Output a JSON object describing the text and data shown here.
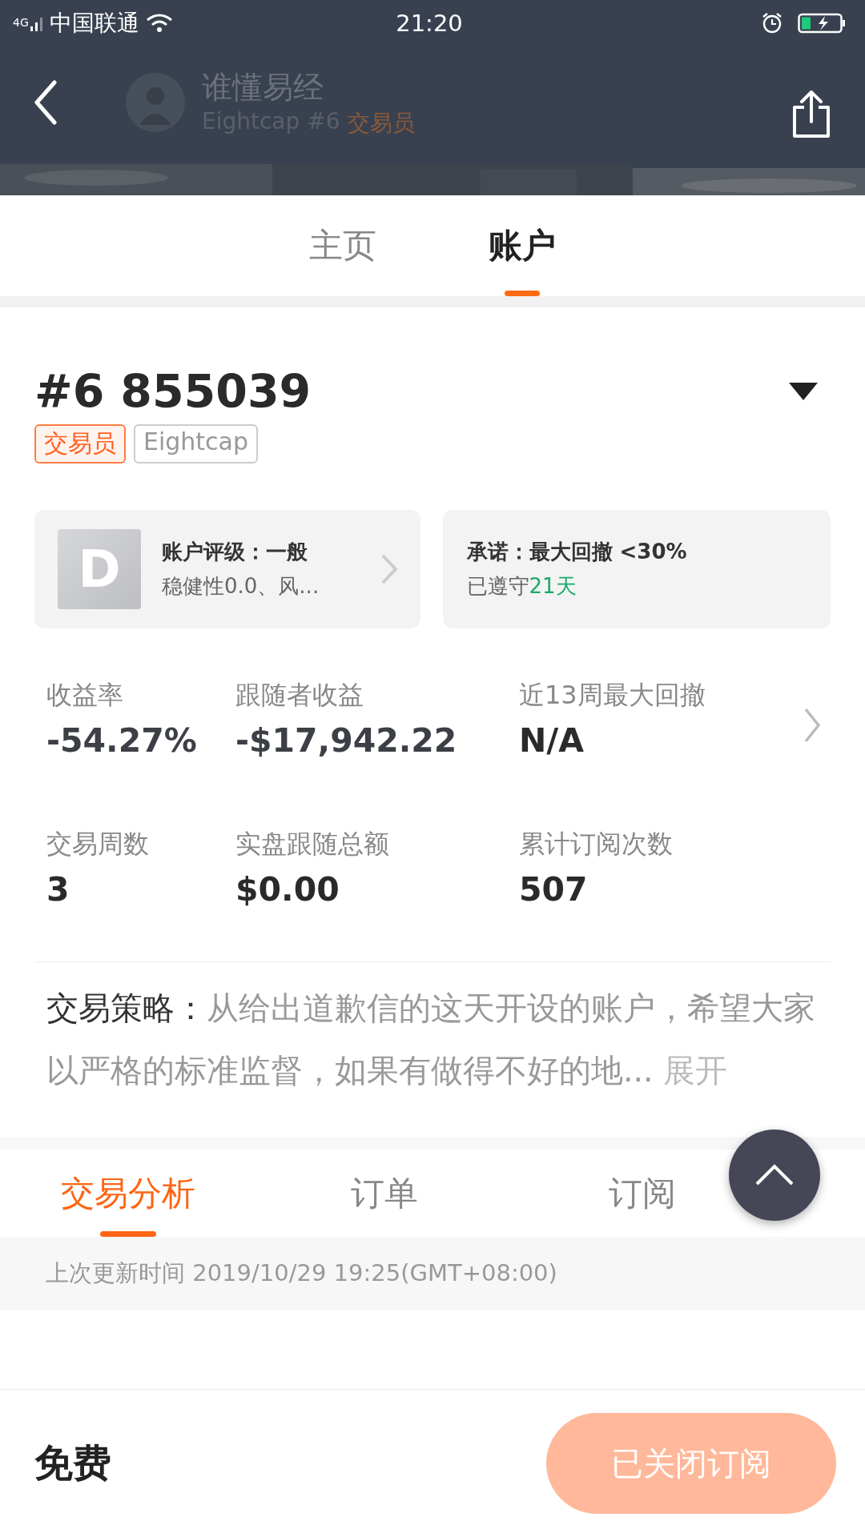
{
  "status_bar": {
    "network": "4G",
    "carrier": "中国联通",
    "time": "21:20"
  },
  "header": {
    "name": "谁懂易经",
    "broker": "Eightcap #6",
    "role": "交易员"
  },
  "tabs": [
    {
      "label": "主页",
      "selected": false
    },
    {
      "label": "账户",
      "selected": true
    }
  ],
  "account": {
    "number": "#6 855039",
    "tags": [
      {
        "label": "交易员",
        "kind": "role"
      },
      {
        "label": "Eightcap",
        "kind": "broker"
      }
    ]
  },
  "rating_card": {
    "grade": "D",
    "title": "账户评级：一般",
    "detail": "稳健性0.0、风..."
  },
  "commitment_card": {
    "title": "承诺：最大回撤 <30%",
    "prefix": "已遵守",
    "highlight": "21天"
  },
  "stats": [
    {
      "label": "收益率",
      "value": "-54.27%"
    },
    {
      "label": "跟随者收益",
      "value": "-$17,942.22"
    },
    {
      "label": "近13周最大回撤",
      "value": "N/A"
    },
    {
      "label": "交易周数",
      "value": "3"
    },
    {
      "label": "实盘跟随总额",
      "value": "$0.00"
    },
    {
      "label": "累计订阅次数",
      "value": "507"
    }
  ],
  "strategy": {
    "label": "交易策略：",
    "text": "从给出道歉信的这天开设的账户，希望大家以严格的标准监督，如果有做得不好的地...",
    "expand": "展开"
  },
  "section_tabs": [
    {
      "label": "交易分析",
      "selected": true
    },
    {
      "label": "订单",
      "selected": false
    },
    {
      "label": "订阅",
      "selected": false
    }
  ],
  "update_text": "上次更新时间 2019/10/29 19:25(GMT+08:00)",
  "footer": {
    "price": "免费",
    "button": "已关闭订阅",
    "disabled": true
  }
}
